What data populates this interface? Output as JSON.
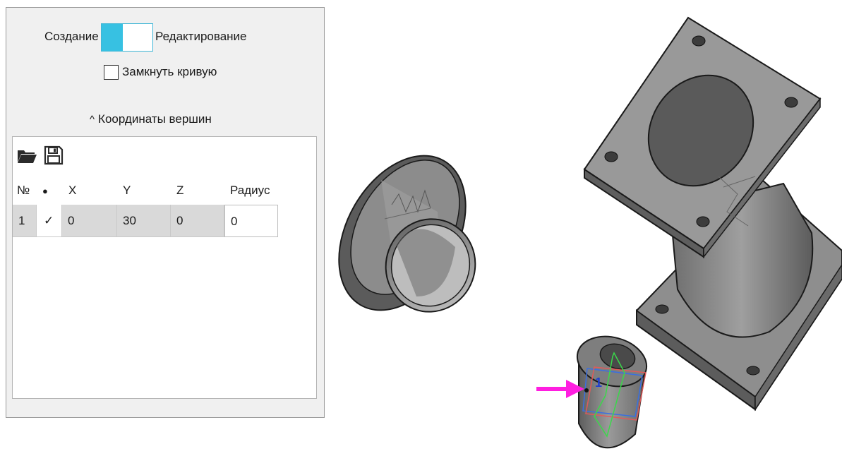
{
  "panel": {
    "mode_left": "Создание",
    "mode_right": "Редактирование",
    "close_curve": "Замкнуть кривую",
    "section_title": "Координаты вершин",
    "table": {
      "headers": [
        "№",
        "●",
        "X",
        "Y",
        "Z",
        "Радиус"
      ],
      "rows": [
        {
          "num": "1",
          "mark": "✓",
          "x": "0",
          "y": "30",
          "z": "0",
          "radius": "0"
        }
      ]
    }
  },
  "viewport": {
    "point_label": "1"
  },
  "colors": {
    "toggle_accent": "#37c1e2",
    "arrow": "#ff1ee0",
    "part_gray": "#8f8f8f"
  },
  "icons": [
    "folder-open-icon",
    "save-icon",
    "caret-up-icon",
    "check-icon"
  ]
}
